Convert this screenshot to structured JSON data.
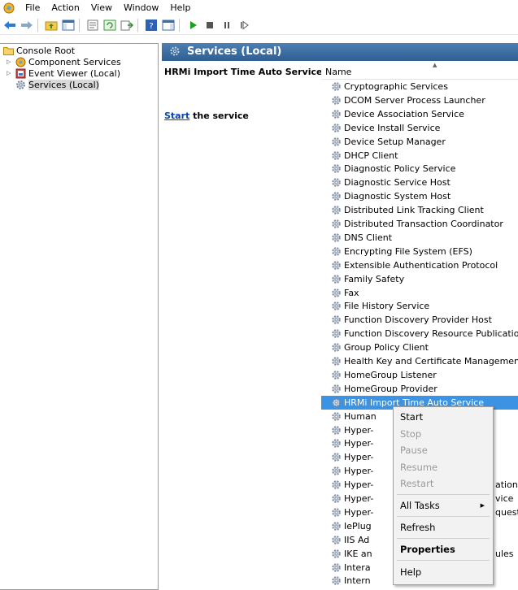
{
  "menubar": {
    "items": [
      "File",
      "Action",
      "View",
      "Window",
      "Help"
    ]
  },
  "tree": {
    "root": "Console Root",
    "children": [
      "Component Services",
      "Event Viewer (Local)",
      "Services (Local)"
    ]
  },
  "panel": {
    "title": "Services (Local)",
    "selected_service": "HRMi Import Time Auto Service",
    "start_link": "Start",
    "start_suffix": " the service"
  },
  "list": {
    "column_name": "Name",
    "rows": [
      "Cryptographic Services",
      "DCOM Server Process Launcher",
      "Device Association Service",
      "Device Install Service",
      "Device Setup Manager",
      "DHCP Client",
      "Diagnostic Policy Service",
      "Diagnostic Service Host",
      "Diagnostic System Host",
      "Distributed Link Tracking Client",
      "Distributed Transaction Coordinator",
      "DNS Client",
      "Encrypting File System (EFS)",
      "Extensible Authentication Protocol",
      "Family Safety",
      "Fax",
      "File History Service",
      "Function Discovery Provider Host",
      "Function Discovery Resource Publication",
      "Group Policy Client",
      "Health Key and Certificate Management",
      "HomeGroup Listener",
      "HomeGroup Provider",
      "HRMi Import Time Auto Service",
      "Human",
      "Hyper-",
      "Hyper-",
      "Hyper-",
      "Hyper-",
      "Hyper-",
      "Hyper-",
      "Hyper-",
      "IePlug",
      "IIS Ad",
      "IKE an",
      "Intera",
      "Intern"
    ],
    "visible_tails": [
      {
        "row": 29,
        "text": "ation S"
      },
      {
        "row": 30,
        "text": "vice"
      },
      {
        "row": 31,
        "text": "queste"
      },
      {
        "row": 34,
        "text": "ules"
      }
    ]
  },
  "context_menu": {
    "start": "Start",
    "stop": "Stop",
    "pause": "Pause",
    "resume": "Resume",
    "restart": "Restart",
    "all_tasks": "All Tasks",
    "refresh": "Refresh",
    "properties": "Properties",
    "help": "Help"
  },
  "colors": {
    "header_blue": "#3b6ea3",
    "selection": "#3c92e3",
    "link": "#0645ad"
  }
}
